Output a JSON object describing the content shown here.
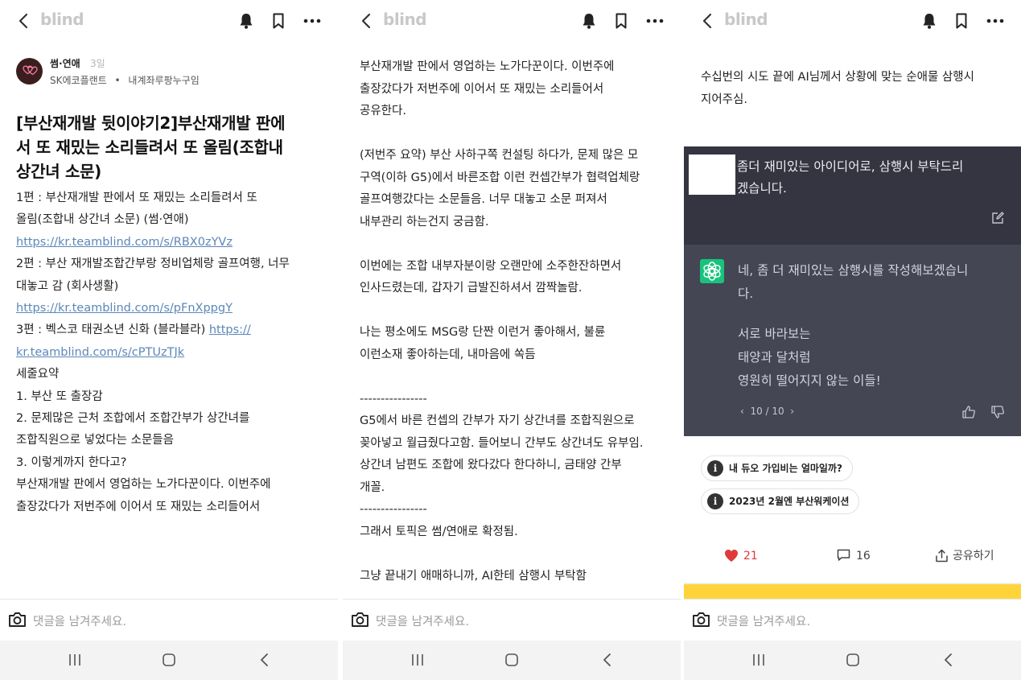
{
  "colors": {
    "link": "#5b87b9",
    "heart": "#e03a3a",
    "chat_dark": "#343541",
    "chat_answer": "#444654",
    "gpt_green": "#19c37d",
    "ad": "#ffd43a"
  },
  "app": {
    "logo": "blind"
  },
  "icons": {
    "back": "back-arrow-icon",
    "bell": "bell-icon",
    "bookmark": "bookmark-icon",
    "more": "more-icon",
    "camera": "camera-icon"
  },
  "screen1": {
    "author": {
      "name": "썸·연애",
      "time": "3일",
      "org": "SK에코플랜트",
      "sep": "•",
      "nickname": "내계좌루팡누구임"
    },
    "title": "[부산재개발 뒷이야기2]부산재개발 판에서 또 재밌는 소리들려서 또 올림(조합내 상간녀 소문)",
    "body": {
      "p1a": "1편 : 부산재개발 판에서 또 재밌는 소리들려서 또",
      "p1b": "올림(조합내 상간녀 소문) (썸·연애)",
      "p1link": "https://kr.teamblind.com/s/RBX0zYVz",
      "p2a": "2편 : 부산 재개발조합간부랑 정비업체랑 골프여행, 너무",
      "p2b": "대놓고 감 (회사생활)",
      "p2link": "https://kr.teamblind.com/s/pFnXppgY",
      "p3a": "3편 : 벡스코 태권소년 신화 (블라블라) ",
      "p3link1": "https://",
      "p3link2": "kr.teamblind.com/s/cPTUzTJk",
      "s_title": "세줄요약",
      "s1": "1. 부산 또 출장감",
      "s2": "2. 문제많은 근처 조합에서 조합간부가 상간녀를",
      "s2b": "조합직원으로 넣었다는 소문들음",
      "s3": "3. 이렇게까지 한다고?",
      "p4": "부산재개발 판에서 영업하는 노가다꾼이다. 이번주에",
      "p4b": "출장갔다가 저번주에 이어서 또 재밌는 소리들어서"
    }
  },
  "screen2": {
    "lines": [
      "부산재개발 판에서 영업하는 노가다꾼이다. 이번주에",
      "출장갔다가 저번주에 이어서 또 재밌는 소리들어서",
      "공유한다.",
      "",
      "(저번주 요약) 부산 사하구쪽 컨설팅 하다가, 문제 많은 모",
      "구역(이하 G5)에서 바른조합 이런 컨셉간부가 협력업체랑",
      "골프여행갔다는 소문들음. 너무 대놓고 소문 퍼져서",
      "내부관리 하는건지 궁금함.",
      "",
      "이번에는 조합 내부자분이랑 오랜만에 소주한잔하면서",
      "인사드렸는데, 갑자기 급발진하셔서 깜짝놀람.",
      "",
      "나는 평소에도 MSG랑 단짠 이런거 좋아해서, 불륜",
      "이런소재 좋아하는데, 내마음에 쏙듬",
      "",
      "----------------",
      "G5에서 바른 컨셉의 간부가 자기 상간녀를 조합직원으로",
      "꽂아넣고 월급줬다고함. 들어보니 간부도 상간녀도 유부임.",
      "상간녀 남편도 조합에 왔다갔다 한다하니, 금태양 간부",
      "개꼴.",
      "----------------",
      "그래서 토픽은 썸/연애로 확정됨.",
      "",
      "그냥 끝내기 애매하니까, AI한테 삼행시 부탁함"
    ]
  },
  "screen3": {
    "intro1": "수십번의 시도 끝에 AI님께서 상황에 맞는 순애물 삼행시",
    "intro2": "지어주심.",
    "question1": "좀더 재미있는 아이디어로, 삼행시 부탁드리",
    "question2": "겠습니다.",
    "answer1": "네, 좀 더 재미있는 삼행시를 작성해보겠습니",
    "answer2": "다.",
    "poem": [
      "서로 바라보는",
      "태양과 달처럼",
      "영원히 떨어지지 않는 이들!"
    ],
    "pager": "10 / 10",
    "chips": [
      "내 듀오 가입비는 얼마일까?",
      "2023년 2월엔 부산워케이션"
    ],
    "chip_icon": "i",
    "likes": "21",
    "comments": "16",
    "share": "공유하기"
  },
  "comment": {
    "placeholder": "댓글을 남겨주세요."
  }
}
